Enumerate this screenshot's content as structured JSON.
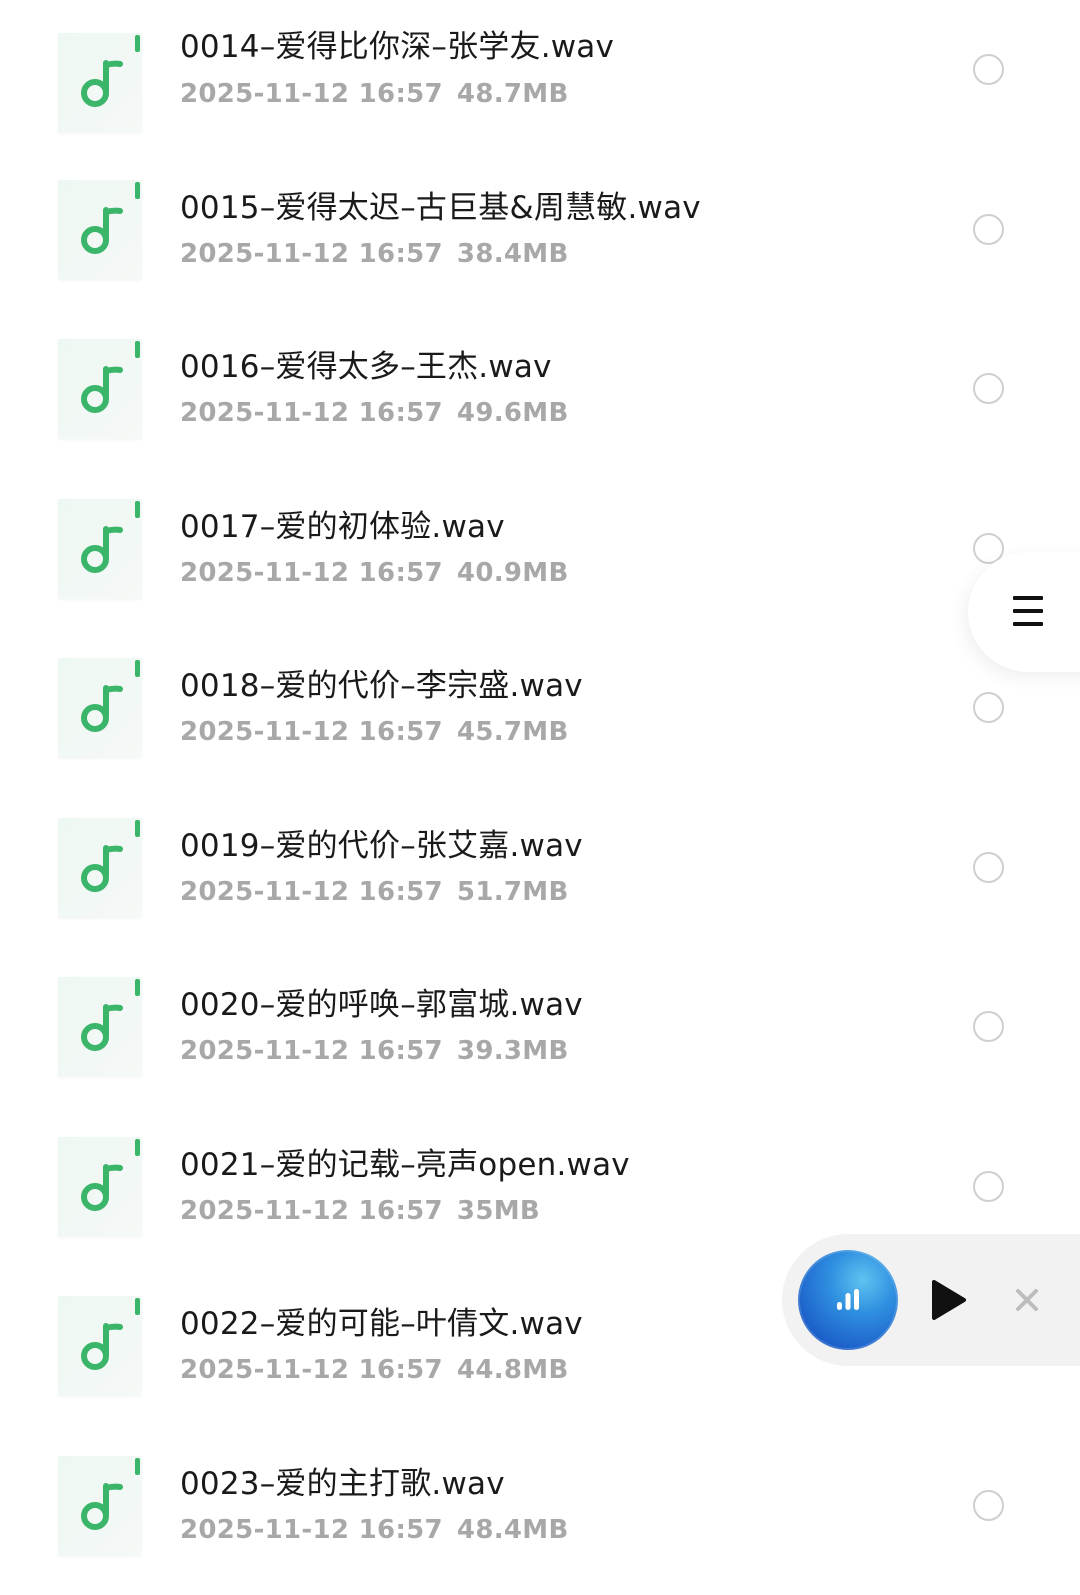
{
  "files": [
    {
      "name": "0014–爱得比你深–张学友.wav",
      "date": "2025-11-12 16:57",
      "size": "48.7MB"
    },
    {
      "name": "0015–爱得太迟–古巨基&周慧敏.wav",
      "date": "2025-11-12 16:57",
      "size": "38.4MB"
    },
    {
      "name": "0016–爱得太多–王杰.wav",
      "date": "2025-11-12 16:57",
      "size": "49.6MB"
    },
    {
      "name": "0017–爱的初体验.wav",
      "date": "2025-11-12 16:57",
      "size": "40.9MB"
    },
    {
      "name": "0018–爱的代价–李宗盛.wav",
      "date": "2025-11-12 16:57",
      "size": "45.7MB"
    },
    {
      "name": "0019–爱的代价–张艾嘉.wav",
      "date": "2025-11-12 16:57",
      "size": "51.7MB"
    },
    {
      "name": "0020–爱的呼唤–郭富城.wav",
      "date": "2025-11-12 16:57",
      "size": "39.3MB"
    },
    {
      "name": "0021–爱的记载–亮声open.wav",
      "date": "2025-11-12 16:57",
      "size": "35MB"
    },
    {
      "name": "0022–爱的可能–叶倩文.wav",
      "date": "2025-11-12 16:57",
      "size": "44.8MB"
    },
    {
      "name": "0023–爱的主打歌.wav",
      "date": "2025-11-12 16:57",
      "size": "48.4MB"
    }
  ],
  "icons": {
    "file_type": "music-note-icon",
    "select": "radio-circle-icon",
    "menu": "hamburger-menu-icon",
    "player_disc": "audio-bars-icon",
    "play": "play-icon",
    "close": "close-icon"
  },
  "colors": {
    "accent_green": "#3bb56a",
    "player_blue": "#1c5fc9",
    "meta_gray": "#a8a8a8",
    "text": "#1a1a1a"
  }
}
